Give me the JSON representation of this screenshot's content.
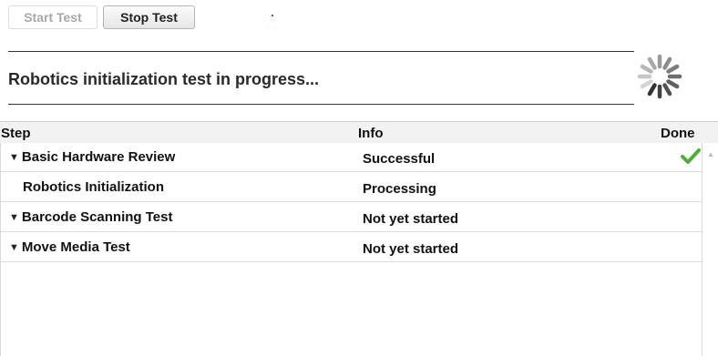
{
  "toolbar": {
    "start_label": "Start Test",
    "stop_label": "Stop Test"
  },
  "status": {
    "message": "Robotics initialization test in progress..."
  },
  "table": {
    "headers": {
      "step": "Step",
      "info": "Info",
      "done": "Done"
    },
    "rows": [
      {
        "step": "Basic Hardware Review",
        "info": "Successful",
        "expandable": true,
        "done": true
      },
      {
        "step": "Robotics Initialization",
        "info": "Processing",
        "expandable": false,
        "done": false
      },
      {
        "step": "Barcode Scanning Test",
        "info": "Not yet started",
        "expandable": true,
        "done": false
      },
      {
        "step": "Move Media Test",
        "info": "Not yet started",
        "expandable": true,
        "done": false
      }
    ]
  },
  "colors": {
    "success_check": "#4caf3a",
    "spinner": "#333333"
  },
  "icons": {
    "spinner": "loading-spinner-icon",
    "caret": "caret-down-icon",
    "check": "checkmark-icon",
    "scroll_up": "scroll-up-arrow-icon"
  }
}
